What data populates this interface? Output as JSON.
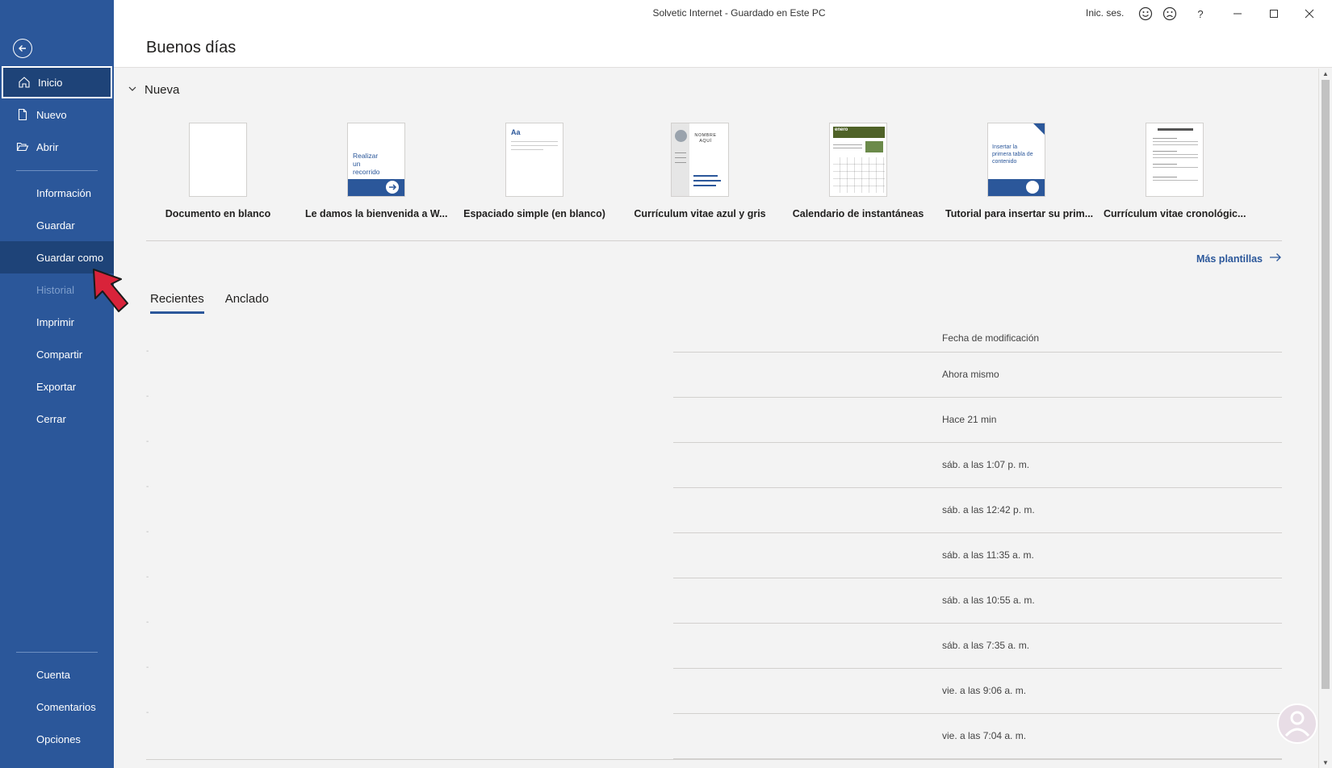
{
  "titlebar": {
    "doc_title": "Solvetic Internet  -  Guardado en Este PC",
    "signin": "Inic. ses.",
    "help": "?"
  },
  "header": {
    "greeting": "Buenos días"
  },
  "sidebar": {
    "items": [
      {
        "label": "Inicio"
      },
      {
        "label": "Nuevo"
      },
      {
        "label": "Abrir"
      },
      {
        "label": "Información"
      },
      {
        "label": "Guardar"
      },
      {
        "label": "Guardar como"
      },
      {
        "label": "Historial"
      },
      {
        "label": "Imprimir"
      },
      {
        "label": "Compartir"
      },
      {
        "label": "Exportar"
      },
      {
        "label": "Cerrar"
      },
      {
        "label": "Cuenta"
      },
      {
        "label": "Comentarios"
      },
      {
        "label": "Opciones"
      }
    ],
    "active": "Inicio",
    "highlighted": "Guardar como",
    "disabled": "Historial"
  },
  "new_section": {
    "title": "Nueva",
    "templates": [
      {
        "label": "Documento en blanco"
      },
      {
        "label": "Le damos la bienvenida a W...",
        "thumb_text": "Realizar un recorrido"
      },
      {
        "label": "Espaciado simple (en blanco)",
        "thumb_text": "Aa"
      },
      {
        "label": "Currículum vitae azul y gris",
        "thumb_text": "NOMBRE AQUÍ"
      },
      {
        "label": "Calendario de instantáneas",
        "thumb_text": "enero"
      },
      {
        "label": "Tutorial para insertar su prim...",
        "thumb_text": "Insertar la primera tabla de contenido"
      },
      {
        "label": "Currículum vitae cronológic..."
      }
    ],
    "more_templates": "Más plantillas"
  },
  "recent": {
    "tabs": [
      {
        "label": "Recientes"
      },
      {
        "label": "Anclado"
      }
    ],
    "active_tab": "Recientes",
    "column_header": "Fecha de modificación",
    "rows": [
      {
        "time": "Ahora mismo"
      },
      {
        "time": "Hace 21 min"
      },
      {
        "time": "sáb. a las 1:07 p. m."
      },
      {
        "time": "sáb. a las 12:42 p. m."
      },
      {
        "time": "sáb. a las 11:35 a. m."
      },
      {
        "time": "sáb. a las 10:55 a. m."
      },
      {
        "time": "sáb. a las 7:35 a. m."
      },
      {
        "time": "vie. a las 9:06 a. m."
      },
      {
        "time": "vie. a las 7:04 a. m."
      }
    ]
  },
  "colors": {
    "sidebar_bg": "#2b579a",
    "sidebar_active": "#1e4378",
    "accent": "#2b579a",
    "annotation_arrow": "#d9233a"
  }
}
